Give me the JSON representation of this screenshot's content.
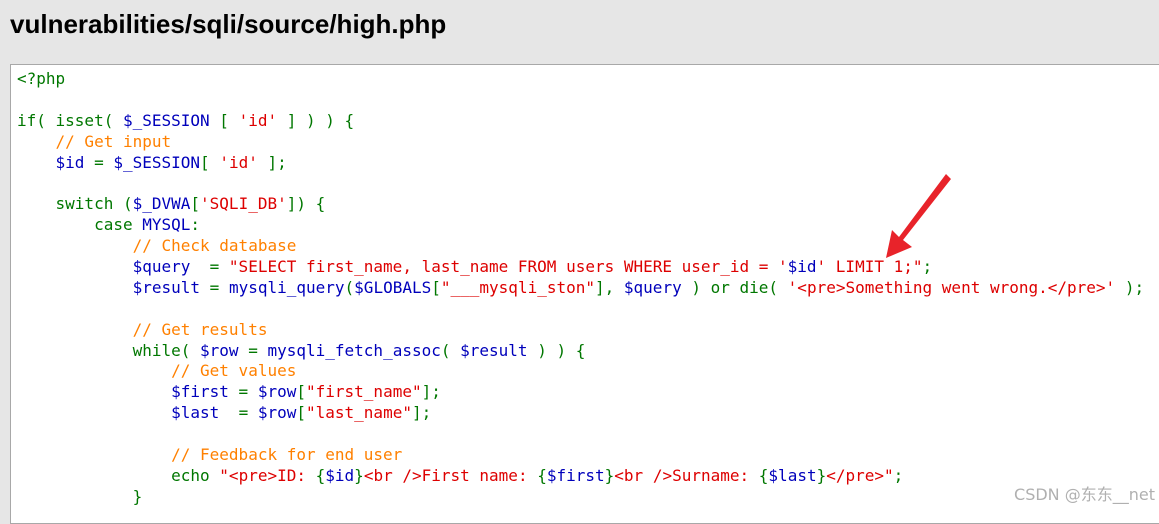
{
  "page": {
    "title": "vulnerabilities/sqli/source/high.php",
    "watermark": "CSDN @东东__net"
  },
  "colors": {
    "default": "#0000BB",
    "keyword": "#007700",
    "comment": "#FF8000",
    "string": "#DD0000",
    "annotation_arrow": "#e8232a"
  },
  "code": {
    "l0": [
      "<?php"
    ],
    "l1": [],
    "l2": [
      "if( isset( ",
      "$_SESSION",
      " [ ",
      "'id'",
      " ] ) ) {"
    ],
    "l3": [
      "    ",
      "// Get input"
    ],
    "l4": [
      "    ",
      "$id",
      " = ",
      "$_SESSION",
      "[ ",
      "'id'",
      " ];"
    ],
    "l5": [],
    "l6": [
      "    switch (",
      "$_DVWA",
      "[",
      "'SQLI_DB'",
      "]) {"
    ],
    "l7": [
      "        case ",
      "MYSQL",
      ":"
    ],
    "l8": [
      "            ",
      "// Check database"
    ],
    "l9": [
      "            ",
      "$query",
      "  = ",
      "\"SELECT first_name, last_name FROM users WHERE user_id = '",
      "$id",
      "' LIMIT 1;\"",
      ";"
    ],
    "l10": [
      "            ",
      "$result",
      " = ",
      "mysqli_query",
      "(",
      "$GLOBALS",
      "[",
      "\"___mysqli_ston\"",
      "], ",
      "$query",
      " ) or die( ",
      "'<pre>Something went wrong.</pre>'",
      " );"
    ],
    "l11": [],
    "l12": [
      "            ",
      "// Get results"
    ],
    "l13": [
      "            while( ",
      "$row",
      " = ",
      "mysqli_fetch_assoc",
      "( ",
      "$result",
      " ) ) {"
    ],
    "l14": [
      "                ",
      "// Get values"
    ],
    "l15": [
      "                ",
      "$first",
      " = ",
      "$row",
      "[",
      "\"first_name\"",
      "];"
    ],
    "l16": [
      "                ",
      "$last",
      "  = ",
      "$row",
      "[",
      "\"last_name\"",
      "];"
    ],
    "l17": [],
    "l18": [
      "                ",
      "// Feedback for end user"
    ],
    "l19": [
      "                echo ",
      "\"<pre>ID: ",
      "{",
      "$id",
      "}",
      "<br />First name: ",
      "{",
      "$first",
      "}",
      "<br />Surname: ",
      "{",
      "$last",
      "}",
      "</pre>\"",
      ";"
    ],
    "l20": [
      "            }"
    ]
  }
}
